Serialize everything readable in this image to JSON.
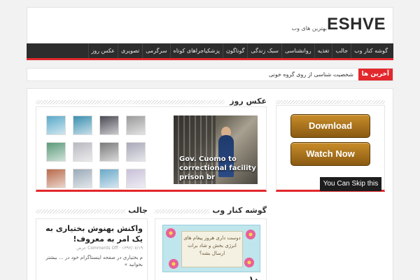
{
  "header": {
    "logo": "ESHVE",
    "tagline": "بهترین های وب"
  },
  "nav": {
    "items": [
      "گوشه کنار وب",
      "جالب",
      "تغذیه",
      "روانشناسی",
      "سبک زندگی",
      "گوناگون",
      "پزشکیاجراهای کوتاه",
      "سرگرمی",
      "تصویری",
      "عکس روز"
    ]
  },
  "ticker": {
    "label": "آخرین ها",
    "text": "شخصیت شناسی از روی گروه خونی"
  },
  "photo_section": {
    "title": "عکس روز",
    "caption_lines": [
      "Gov. Cuomo to",
      "correctional facility a",
      "prison br"
    ],
    "thumb_colors": [
      "#5aa9c9",
      "#3a8fb0",
      "#4a4a55",
      "#9a9a9a",
      "#5a9a7a",
      "#b8b8c0",
      "#7a7a7a",
      "#a8a8b8",
      "#b86a4a",
      "#9aaab8",
      "#6aa8c8",
      "#c8c0d8"
    ]
  },
  "sidebar": {
    "download_label": "Download",
    "watch_label": "Watch Now",
    "skip_label": "You Can Skip this in 5"
  },
  "jaleb": {
    "title": "جالب",
    "article_title": "واکنش بهنوش بختیاری به یک امر به معروف!",
    "meta": "Comments Off · ۱۳۹۲/۰۷/۱۹ عرض",
    "excerpt": "م بختیاری در صفحه اینستاگرام خود در ... بیشتر بخوانید »"
  },
  "gooshe": {
    "title": "گوشه کنار وب",
    "promo_text": "دوست داری هروز پیغام های انرژی بخش و شاد برات ارسال بشه؟",
    "next_title": "۱۰ ..."
  }
}
